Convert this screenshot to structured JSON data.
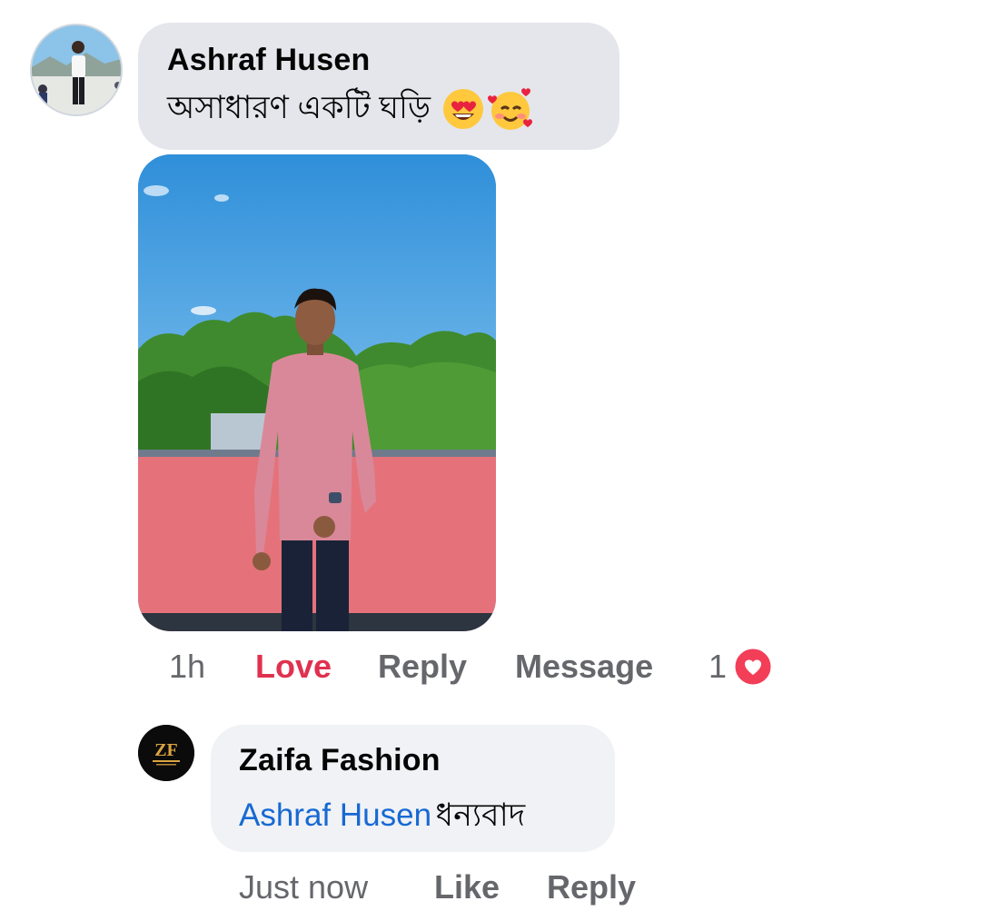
{
  "comment": {
    "author": "Ashraf Husen",
    "text": "অসাধারণ একটি ঘড়ি",
    "emojis": [
      "heart-eyes-emoji",
      "smiling-face-with-hearts-emoji"
    ],
    "photo": "photo-man-pink-shirt-by-wall",
    "actions": {
      "time": "1h",
      "love": "Love",
      "reply": "Reply",
      "message": "Message",
      "reaction_count": "1"
    },
    "colors": {
      "bubble": "#e4e6eb",
      "love": "#e0314f",
      "action": "#65676b"
    }
  },
  "reply": {
    "author": "Zaifa Fashion",
    "mention": "Ashraf Husen",
    "text": "ধন্যবাদ",
    "avatar_logo": "ZF",
    "actions": {
      "time": "Just now",
      "like": "Like",
      "reply": "Reply"
    },
    "colors": {
      "bubble": "#f0f2f5",
      "mention": "#1769d3"
    }
  }
}
